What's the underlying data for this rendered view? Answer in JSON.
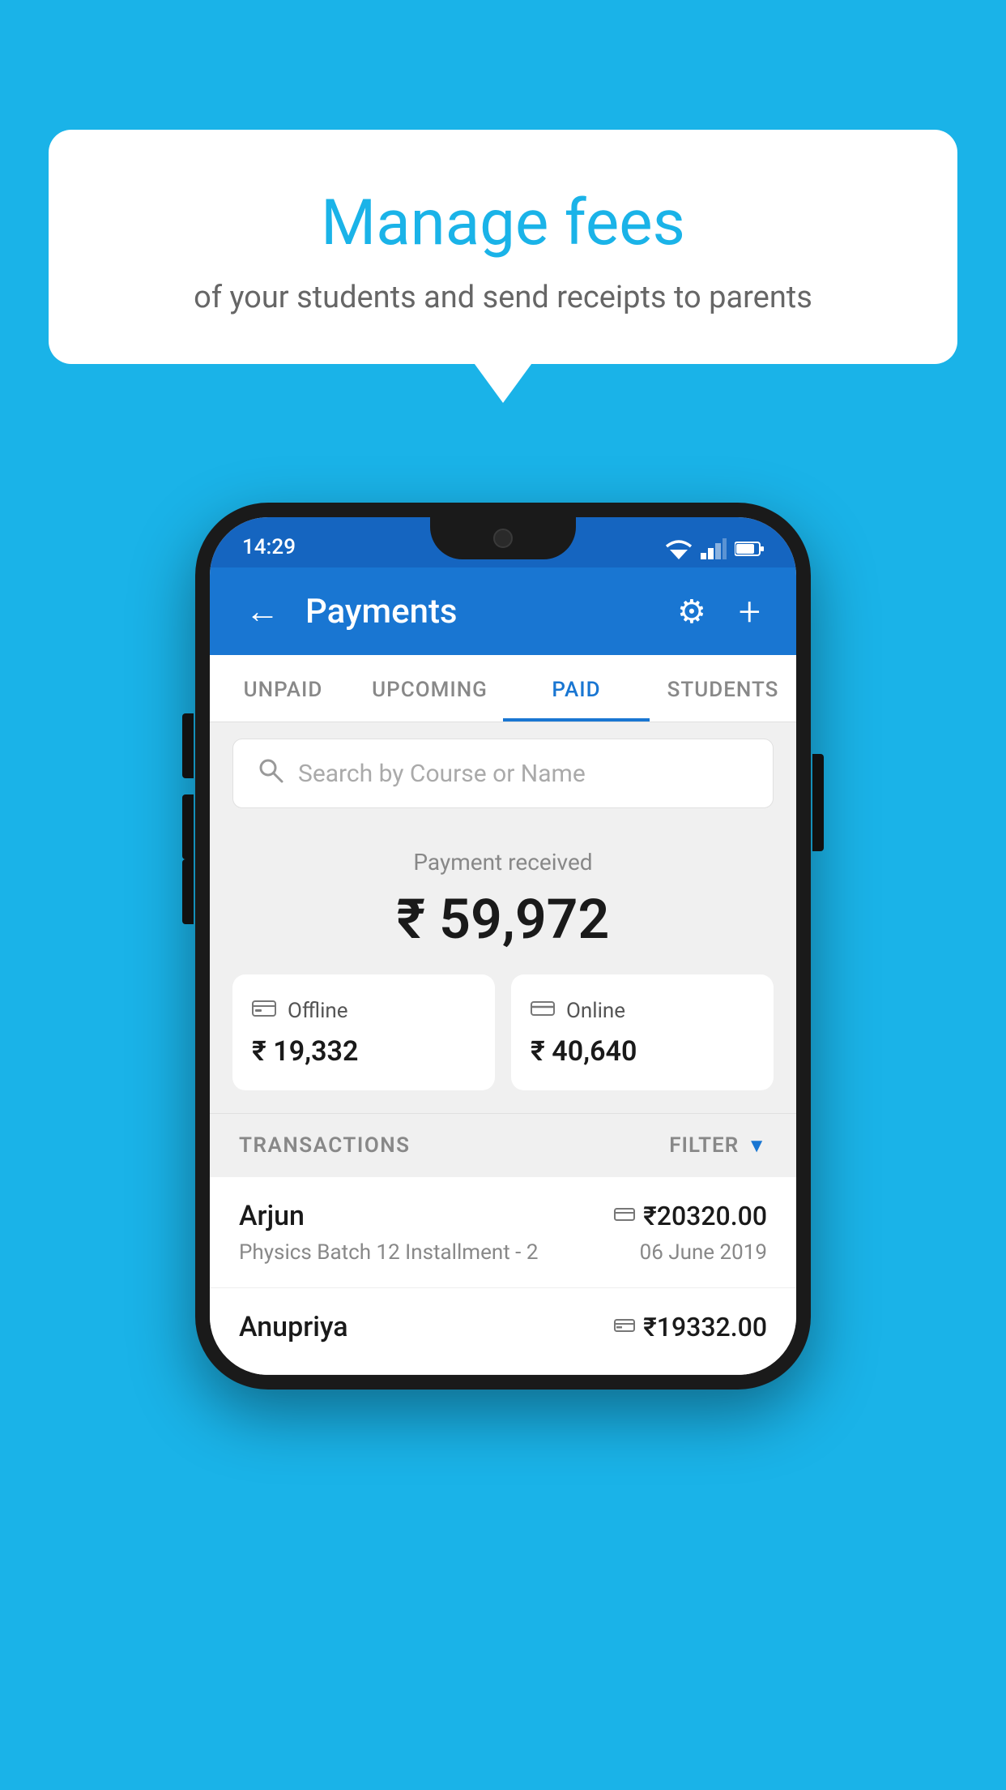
{
  "background": {
    "color": "#1ab3e8"
  },
  "bubble": {
    "title": "Manage fees",
    "subtitle": "of your students and send receipts to parents"
  },
  "phone": {
    "status_bar": {
      "time": "14:29"
    },
    "app_bar": {
      "title": "Payments",
      "back_icon": "←",
      "gear_icon": "⚙",
      "add_icon": "+"
    },
    "tabs": [
      {
        "label": "UNPAID",
        "active": false
      },
      {
        "label": "UPCOMING",
        "active": false
      },
      {
        "label": "PAID",
        "active": true
      },
      {
        "label": "STUDENTS",
        "active": false
      }
    ],
    "search": {
      "placeholder": "Search by Course or Name"
    },
    "payment_summary": {
      "label": "Payment received",
      "amount": "₹ 59,972",
      "offline_label": "Offline",
      "offline_amount": "₹ 19,332",
      "online_label": "Online",
      "online_amount": "₹ 40,640"
    },
    "transactions": {
      "header_label": "TRANSACTIONS",
      "filter_label": "FILTER",
      "items": [
        {
          "name": "Arjun",
          "amount": "₹20320.00",
          "description": "Physics Batch 12 Installment - 2",
          "date": "06 June 2019",
          "payment_type": "online"
        },
        {
          "name": "Anupriya",
          "amount": "₹19332.00",
          "description": "",
          "date": "",
          "payment_type": "offline"
        }
      ]
    }
  }
}
